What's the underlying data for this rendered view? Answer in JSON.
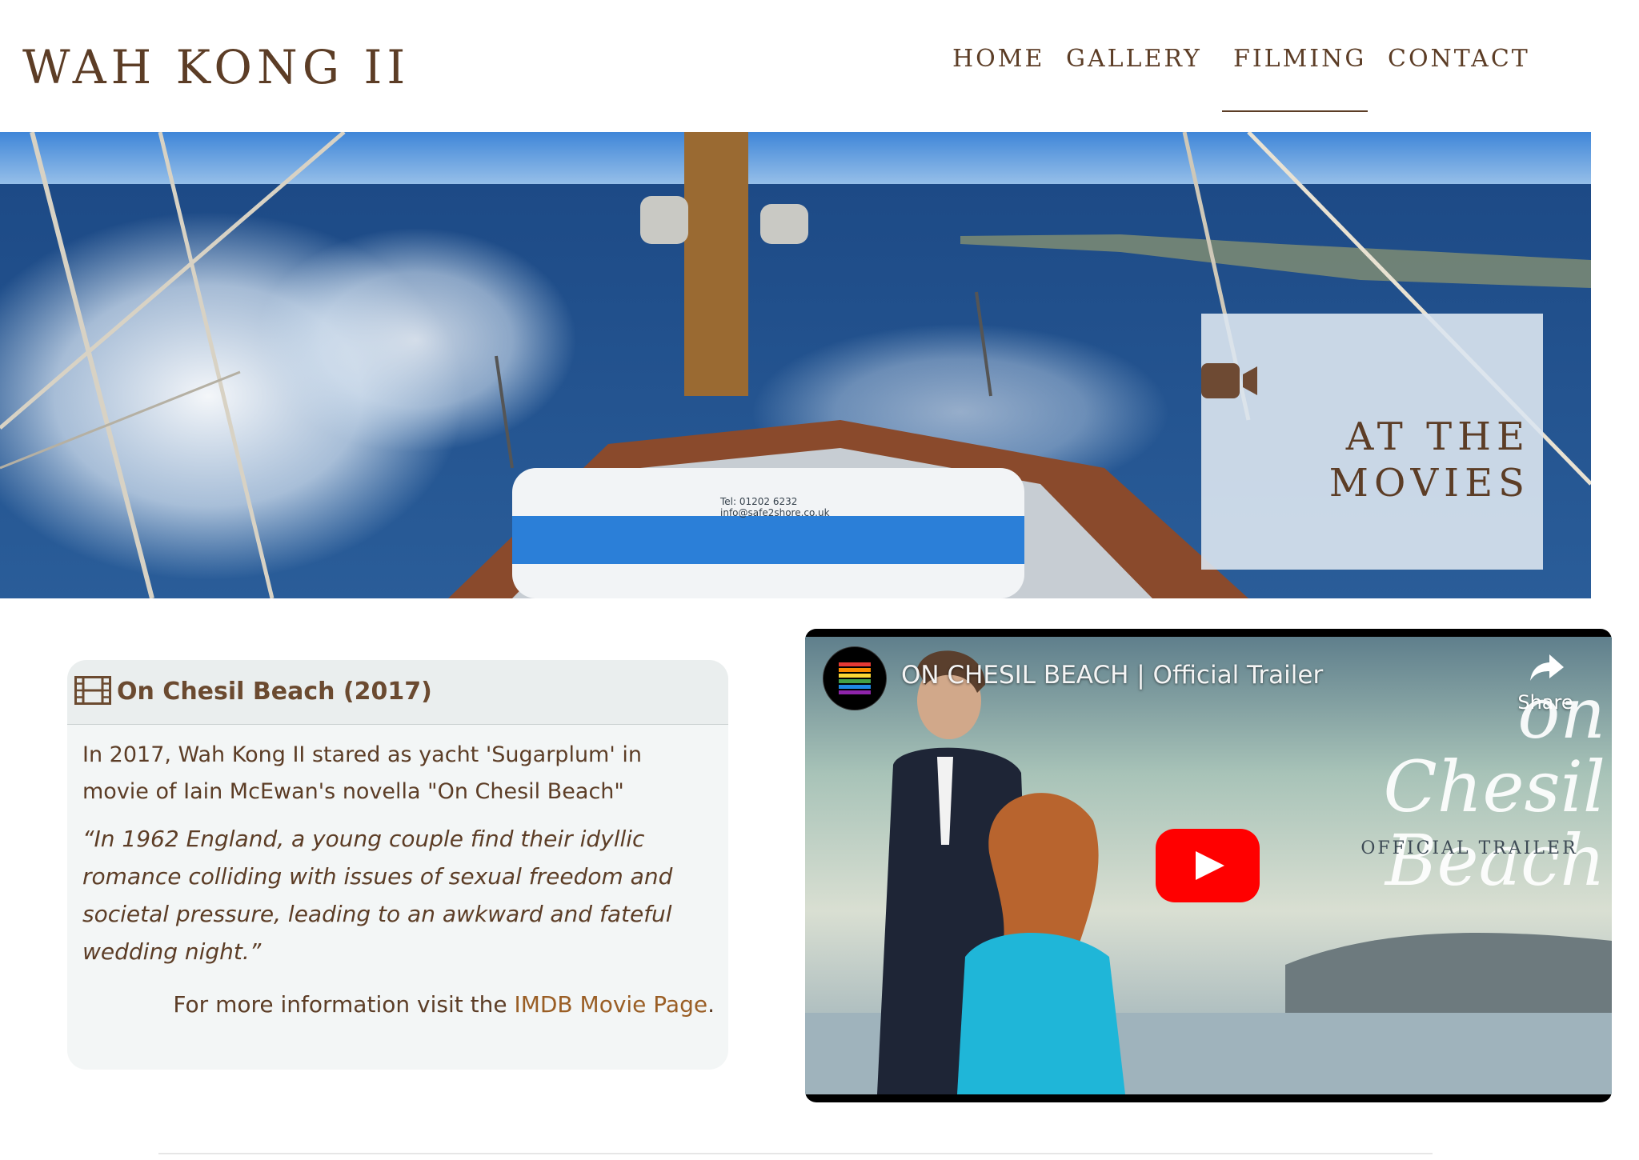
{
  "site": {
    "title": "WAH KONG II"
  },
  "nav": {
    "items": [
      {
        "label": "HOME",
        "active": false
      },
      {
        "label": "GALLERY",
        "active": false
      },
      {
        "label": "FILMING",
        "active": true
      },
      {
        "label": "CONTACT",
        "active": false
      }
    ]
  },
  "hero": {
    "heading": "AT THE MOVIES",
    "icon": "video-camera-icon",
    "liferaft_text": "Tel: 01202 6232\ninfo@safe2shore.co.uk"
  },
  "movie": {
    "icon": "film-strip-icon",
    "title": "On Chesil Beach (2017)",
    "intro": "In 2017, Wah Kong II stared as yacht 'Sugarplum' in movie of Iain McEwan's novella \"On Chesil Beach\"",
    "quote": "“In 1962 England, a young couple find their idyllic romance colliding with issues of sexual freedom and societal pressure, leading to an awkward and fateful wedding night.”",
    "more_prefix": "For more information visit the ",
    "more_link": "IMDB Movie Page",
    "more_suffix": "."
  },
  "video": {
    "title": "ON CHESIL BEACH | Official Trailer",
    "share_label": "Share",
    "poster_script": "on\nChesil\nBeach",
    "poster_sub": "OFFICIAL TRAILER",
    "play_icon": "youtube-play-icon"
  },
  "colors": {
    "brand_brown": "#5c3d26",
    "link": "#9a5e25",
    "youtube_red": "#ff0000"
  }
}
